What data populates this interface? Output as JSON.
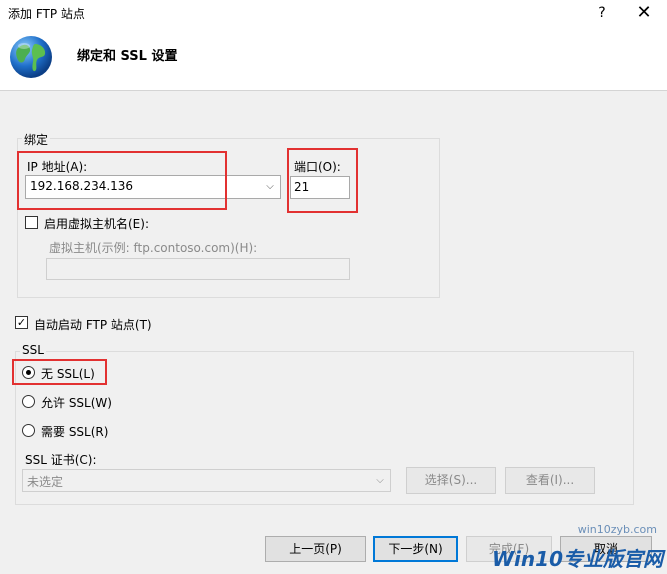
{
  "window": {
    "title": "添加 FTP 站点",
    "help": "?",
    "close": "✕"
  },
  "header": {
    "title": "绑定和 SSL 设置"
  },
  "binding": {
    "group_label": "绑定",
    "ip_label": "IP 地址(A):",
    "ip_value": "192.168.234.136",
    "port_label": "端口(O):",
    "port_value": "21",
    "vhost_checkbox_label": "启用虚拟主机名(E):",
    "vhost_label": "虚拟主机(示例: ftp.contoso.com)(H):",
    "vhost_value": ""
  },
  "autostart": {
    "label": "自动启动 FTP 站点(T)",
    "checked": true
  },
  "ssl": {
    "group_label": "SSL",
    "options": [
      {
        "label": "无 SSL(L)",
        "selected": true
      },
      {
        "label": "允许 SSL(W)",
        "selected": false
      },
      {
        "label": "需要 SSL(R)",
        "selected": false
      }
    ],
    "cert_label": "SSL 证书(C):",
    "cert_value": "未选定",
    "select_button": "选择(S)...",
    "view_button": "查看(I)..."
  },
  "footer": {
    "prev_button": "上一页(P)",
    "next_button": "下一步(N)",
    "finish_button": "完成(F)",
    "cancel_button": "取消"
  },
  "watermark": {
    "url": "win10zyb.com",
    "brand": "Win10专业版官网"
  },
  "colors": {
    "highlight": "#e23131",
    "accent": "#0078d7"
  }
}
